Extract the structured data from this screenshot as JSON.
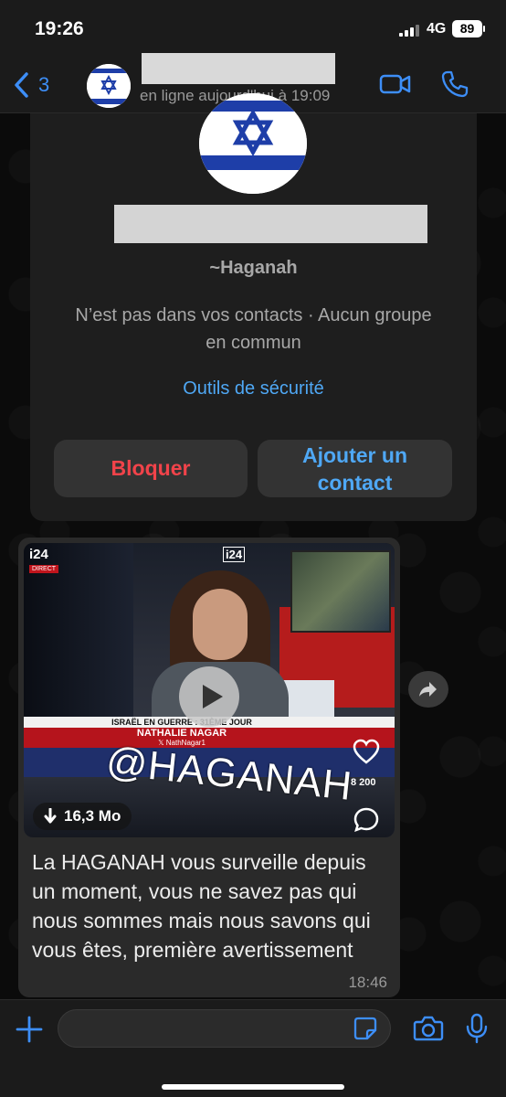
{
  "status_bar": {
    "time": "19:26",
    "network": "4G",
    "battery": "89"
  },
  "header": {
    "back_count": "3",
    "last_seen": "en ligne aujourd'hui à 19:09"
  },
  "info_card": {
    "pushname": "~Haganah",
    "contact_info": "N’est pas dans vos contacts · Aucun groupe en commun",
    "security_link": "Outils de sécurité",
    "block_label": "Bloquer",
    "add_contact_label": "Ajouter un contact"
  },
  "message": {
    "video": {
      "channel_logo": "i24",
      "live_tag": "DIRECT",
      "banner_text": "ISRAËL EN GUERRE : 31ÈME JOUR",
      "presenter_name": "NATHALIE NAGAR",
      "presenter_handle": "𝕏 NathNagar1",
      "watermark": "@HAGANAH",
      "like_count": "8 200",
      "file_size": "16,3 Mo"
    },
    "text": "La HAGANAH vous surveille depuis un moment, vous ne savez pas qui nous sommes mais nous savons qui vous êtes, première avertissement",
    "time": "18:46"
  },
  "input_bar": {
    "placeholder": ""
  },
  "icons": {
    "back": "chevron-left-icon",
    "video_call": "video-camera-icon",
    "voice_call": "phone-icon",
    "forward": "forward-arrow-icon",
    "download": "download-arrow-icon",
    "like": "heart-icon",
    "comment": "comment-bubble-icon",
    "attach": "plus-icon",
    "sticker": "sticker-icon",
    "camera": "camera-icon",
    "mic": "microphone-icon"
  },
  "colors": {
    "accent": "#3d8ef7",
    "danger": "#f1434a",
    "link": "#4fa8f5",
    "flag_blue": "#1e3ea8"
  }
}
